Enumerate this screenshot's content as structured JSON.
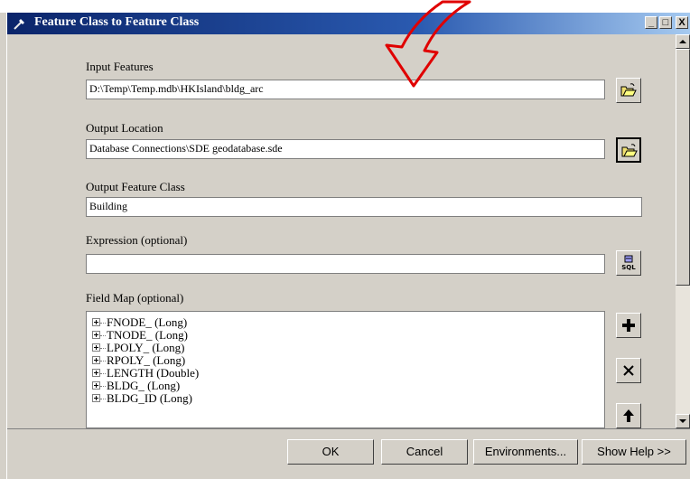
{
  "window": {
    "title": "Feature Class to Feature Class",
    "min_label": "_",
    "max_label": "□",
    "close_label": "X"
  },
  "form": {
    "input_features": {
      "label": "Input Features",
      "value": "D:\\Temp\\Temp.mdb\\HKIsland\\bldg_arc"
    },
    "output_location": {
      "label": "Output Location",
      "value": "Database Connections\\SDE geodatabase.sde"
    },
    "output_feature_class": {
      "label": "Output Feature Class",
      "value": "Building"
    },
    "expression": {
      "label": "Expression (optional)",
      "value": ""
    },
    "field_map": {
      "label": "Field Map (optional)",
      "items": [
        "FNODE_ (Long)",
        "TNODE_ (Long)",
        "LPOLY_ (Long)",
        "RPOLY_ (Long)",
        "LENGTH (Double)",
        "BLDG_ (Long)",
        "BLDG_ID (Long)"
      ]
    }
  },
  "buttons": {
    "ok": "OK",
    "cancel": "Cancel",
    "environments": "Environments...",
    "show_help": "Show Help >>"
  },
  "colors": {
    "titlebar_start": "#0a246a",
    "titlebar_end": "#a6caf0",
    "dialog_bg": "#d4d0c8",
    "annotation_arrow": "#e00000"
  }
}
